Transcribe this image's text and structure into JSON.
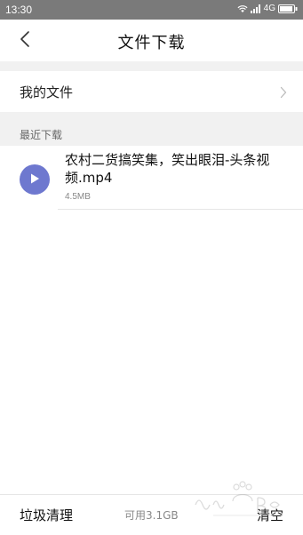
{
  "status_bar": {
    "time": "13:30",
    "network": "4G",
    "icons": [
      "wifi-icon",
      "signal-icon",
      "battery-icon"
    ]
  },
  "header": {
    "title": "文件下载",
    "back_icon": "chevron-left-icon"
  },
  "my_files": {
    "label": "我的文件",
    "chevron_icon": "chevron-right-icon"
  },
  "recent_section": {
    "label": "最近下载"
  },
  "files": [
    {
      "name": "农村二货搞笑集，笑出眼泪-头条视频.mp4",
      "size": "4.5MB",
      "icon": "play-icon"
    }
  ],
  "footer": {
    "trash_clean_label": "垃圾清理",
    "storage_text": "可用3.1GB",
    "clear_label": "清空"
  },
  "colors": {
    "accent": "#6e78cf",
    "status_bar": "#7a7a7a",
    "section_bg": "#f1f1f1"
  }
}
